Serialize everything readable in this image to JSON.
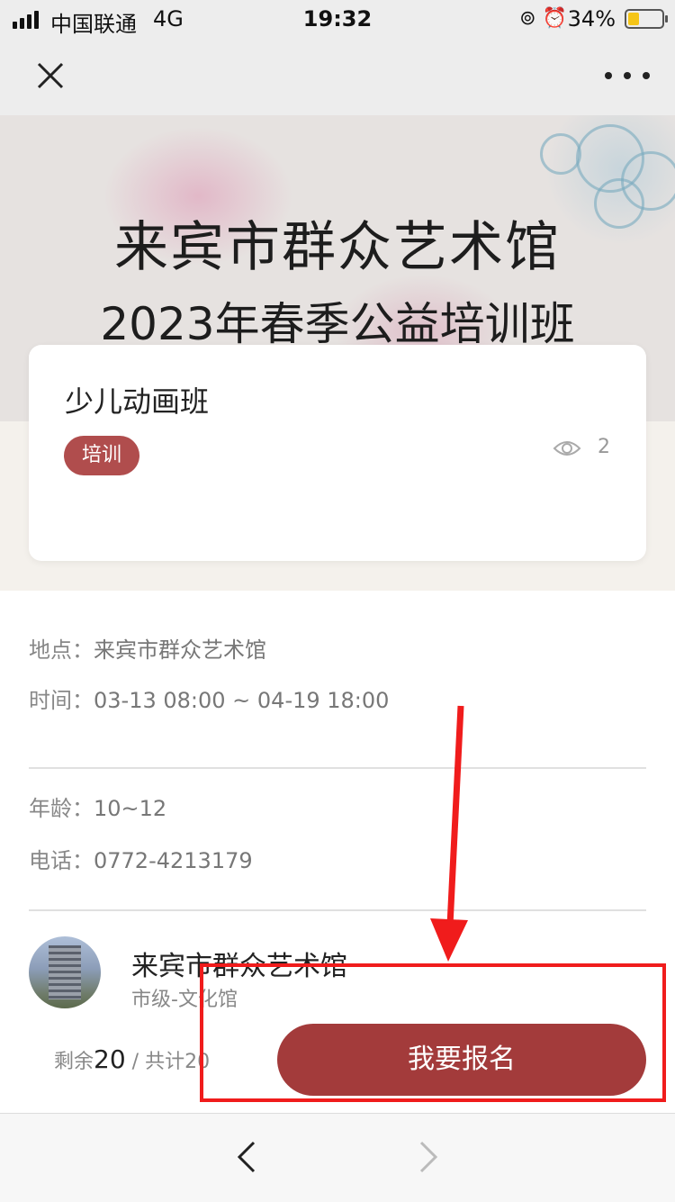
{
  "status_bar": {
    "carrier": "中国联通",
    "network": "4G",
    "time": "19:32",
    "battery": "34%",
    "battery_level": 0.34
  },
  "nav": {
    "close_icon": "close-icon",
    "more_icon": "more-icon"
  },
  "banner": {
    "title": "来宾市群众艺术馆",
    "subtitle": "2023年春季公益培训班"
  },
  "course": {
    "title": "少儿动画班",
    "tag": "培训",
    "views": "2"
  },
  "details": [
    {
      "label": "地点：",
      "value": "来宾市群众艺术馆"
    },
    {
      "label": "时间：",
      "value": "03-13 08:00 ~ 04-19 18:00"
    },
    {
      "label": "年龄：",
      "value": "10~12"
    },
    {
      "label": "电话：",
      "value": "0772-4213179"
    }
  ],
  "organizer": {
    "name": "来宾市群众艺术馆",
    "type": "市级-文化馆"
  },
  "quota": {
    "remaining_label": "剩余",
    "remaining": "20",
    "separator": "/",
    "total_label": "共计",
    "total": "20"
  },
  "signup_button": "我要报名",
  "colors": {
    "accent": "#a33b3b",
    "tag": "#b04d4d",
    "annotation": "#f01c1c"
  }
}
